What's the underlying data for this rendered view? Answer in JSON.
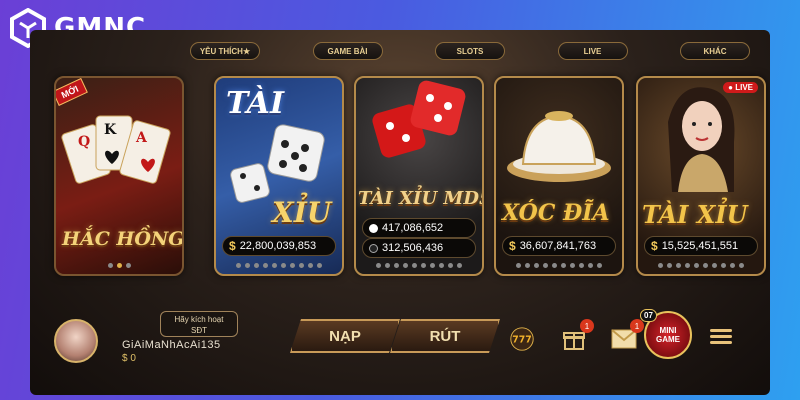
{
  "brand": {
    "name": "GMNC",
    "icon": "gmnc-cube-logo"
  },
  "nav": {
    "tabs": [
      {
        "label": "YÊU THÍCH★"
      },
      {
        "label": "GAME BÀI"
      },
      {
        "label": "SLOTS"
      },
      {
        "label": "LIVE"
      },
      {
        "label": "KHÁC"
      }
    ]
  },
  "games": [
    {
      "title": "HẮC HỒNG",
      "badge": "MỚI",
      "icon": "playing-cards-icon"
    },
    {
      "title_top": "TÀI",
      "title_bottom": "XỈU",
      "jackpot": "22,800,039,853",
      "icon": "dice-icon"
    },
    {
      "title": "TÀI XỈU MD5",
      "jackpot_white": "417,086,652",
      "jackpot_black": "312,506,436",
      "icon": "red-dice-icon"
    },
    {
      "title": "XÓC ĐĨA",
      "jackpot": "36,607,841,763",
      "icon": "xoc-dia-bowl-icon"
    },
    {
      "title": "TÀI XỈU",
      "badge": "LIVE",
      "jackpot": "15,525,451,551",
      "icon": "live-dealer-avatar"
    }
  ],
  "user": {
    "activate_line1": "Hãy kích hoạt",
    "activate_line2": "SĐT",
    "username": "GiAiMaNhAcAi135",
    "balance": "0"
  },
  "actions": {
    "deposit": "NẠP",
    "withdraw": "RÚT"
  },
  "tray": {
    "lucky_label": "777",
    "gift_count": "1",
    "mail_count": "1",
    "minigame_count": "07",
    "minigame_line1": "MINI",
    "minigame_line2": "GAME"
  },
  "colors": {
    "accent_gold": "#e0b24a",
    "brand_bg_start": "#6b3fd6",
    "brand_bg_end": "#2ea0f0"
  }
}
